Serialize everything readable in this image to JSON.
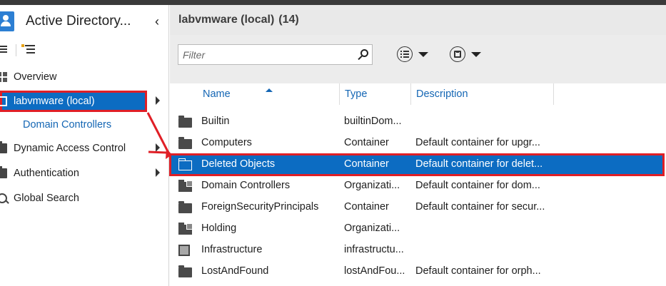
{
  "app": {
    "title": "Active Directory...",
    "collapse_icon": "chevron-left-icon",
    "icon": "user-directory-icon"
  },
  "nav": {
    "view_icons": [
      "list-view-icon",
      "tree-view-icon"
    ],
    "items": [
      {
        "label": "Overview",
        "icon": "grid-icon",
        "has_children": false
      },
      {
        "label": "labvmware (local)",
        "icon": "domain-icon",
        "has_children": true,
        "selected": true
      },
      {
        "label": "Domain Controllers",
        "icon": "",
        "sub": true
      },
      {
        "label": "Dynamic Access Control",
        "icon": "folder-icon",
        "has_children": true
      },
      {
        "label": "Authentication",
        "icon": "folder-icon",
        "has_children": true
      },
      {
        "label": "Global Search",
        "icon": "search-icon",
        "has_children": false
      }
    ]
  },
  "main": {
    "title": "labvmware (local)",
    "count": "(14)",
    "filter_placeholder": "Filter",
    "toolbar_icons": [
      "list-options-icon",
      "save-query-icon"
    ]
  },
  "table": {
    "columns": [
      "Name",
      "Type",
      "Description"
    ],
    "sorted_column": "Name",
    "rows": [
      {
        "name": "Builtin",
        "type": "builtinDom...",
        "description": "",
        "icon": "folder-icon"
      },
      {
        "name": "Computers",
        "type": "Container",
        "description": "Default container for upgr...",
        "icon": "folder-icon"
      },
      {
        "name": "Deleted Objects",
        "type": "Container",
        "description": "Default container for delet...",
        "icon": "folder-icon",
        "selected": true
      },
      {
        "name": "Domain Controllers",
        "type": "Organizati...",
        "description": "Default container for dom...",
        "icon": "ou-icon"
      },
      {
        "name": "ForeignSecurityPrincipals",
        "type": "Container",
        "description": "Default container for secur...",
        "icon": "folder-icon"
      },
      {
        "name": "Holding",
        "type": "Organizati...",
        "description": "",
        "icon": "ou-icon"
      },
      {
        "name": "Infrastructure",
        "type": "infrastructu...",
        "description": "",
        "icon": "infrastructure-icon"
      },
      {
        "name": "LostAndFound",
        "type": "lostAndFou...",
        "description": "Default container for orph...",
        "icon": "folder-icon"
      }
    ]
  },
  "colors": {
    "selection": "#0c6cc2",
    "annotation": "#e01f26",
    "link": "#1466b4",
    "header_bg": "#e9e9e9"
  }
}
